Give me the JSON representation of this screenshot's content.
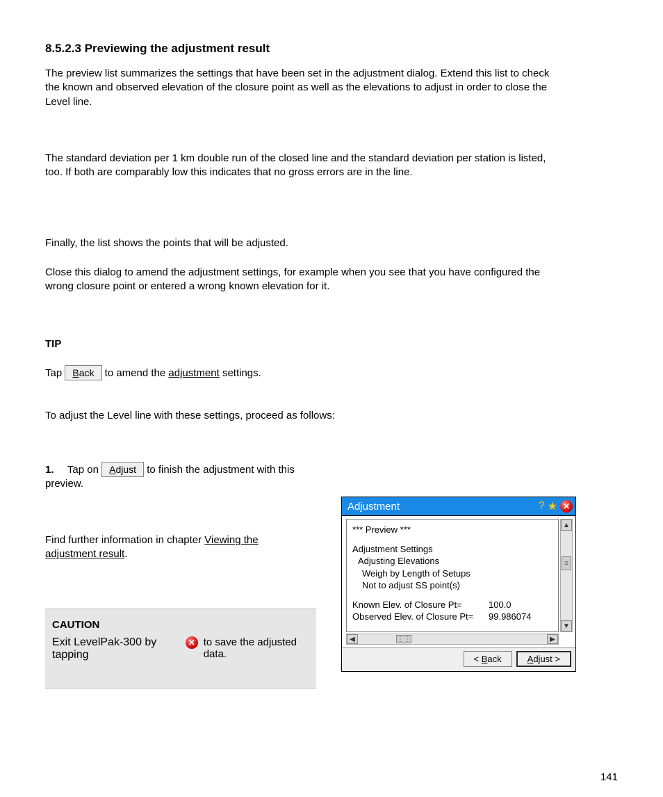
{
  "title": "8.5.2.3 Previewing the adjustment result",
  "para1": "The preview list summarizes the settings that have been set in the adjustment dialog. Extend this list to check the known and observed elevation of the closure point as well as the elevations to adjust in order to close the Level line.",
  "para2": "The standard deviation per 1 km double run of the closed line and the standard deviation per station is listed, too. If both are comparably low this indicates that no gross errors are in the line.",
  "para3": "Finally, the list shows the points that will be adjusted.",
  "para4": "Close this dialog to amend the adjustment settings, for example when you see that you have configured the wrong closure point or entered a wrong known elevation for it.",
  "para5": "TIP",
  "para6_before": "Tap ",
  "para6_btn": "< Back",
  "para6_mid": " to amend the ",
  "para6_link": "adjustment",
  "para6_after": " settings.",
  "para7_prefix": "To adjust the Level line with these settings, proceed as follows:",
  "para8_step_no": "1.",
  "para8_step_prefix": "Tap on ",
  "para8_step_btn": "Adjust",
  "para8_step_after": " to finish the adjustment with this preview.",
  "para9_prefix": "Find further information in chapter ",
  "para9_link": "Viewing the adjustment result",
  "para9_after": ".",
  "caution": {
    "label": "CAUTION",
    "text": "Exit LevelPak-300 by tapping",
    "tail": "to save the adjusted data."
  },
  "dialog": {
    "title": "Adjustment",
    "preview_header": "*** Preview ***",
    "section": "Adjustment Settings",
    "line1": "Adjusting Elevations",
    "line2": "Weigh by Length of Setups",
    "line3": "Not to adjust SS point(s)",
    "kv": [
      {
        "label": "Known Elev. of Closure Pt=",
        "value": "100.0"
      },
      {
        "label": "Observed Elev. of Closure Pt=",
        "value": "99.986074"
      }
    ],
    "back_btn": "< Back",
    "adjust_btn": "Adjust >"
  },
  "page_number": "141"
}
